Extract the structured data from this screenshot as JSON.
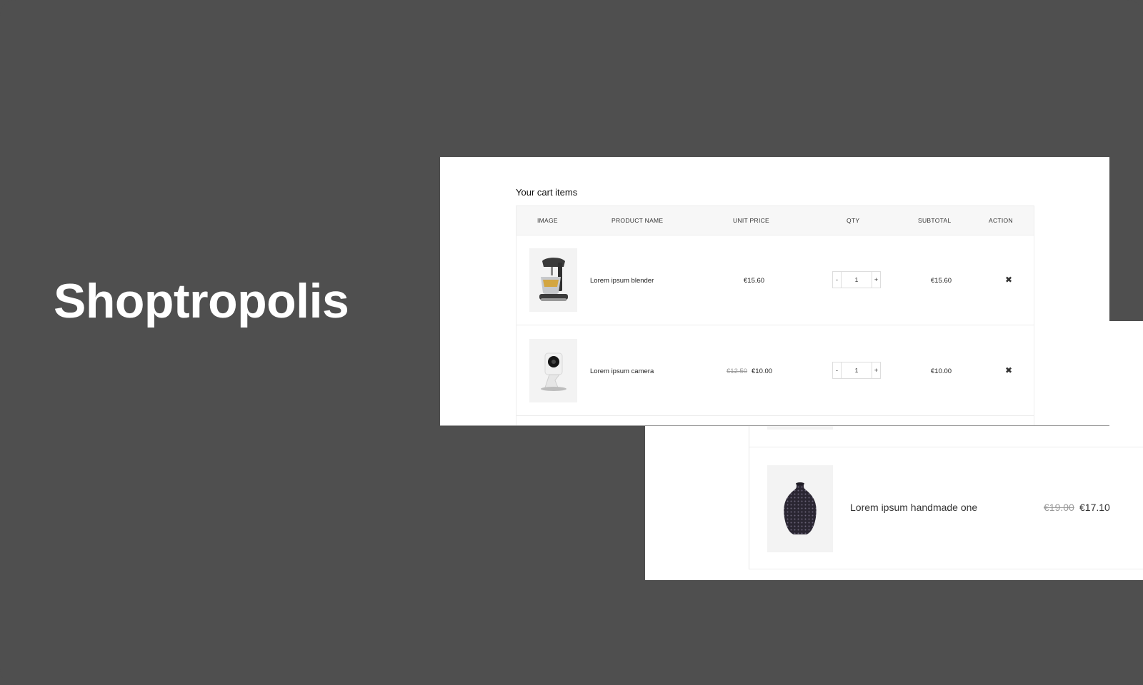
{
  "brand": {
    "name": "Shoptropolis"
  },
  "cart": {
    "title": "Your cart items",
    "columns": [
      "IMAGE",
      "PRODUCT NAME",
      "UNIT PRICE",
      "QTY",
      "SUBTOTAL",
      "ACTION"
    ],
    "rows": [
      {
        "image_icon": "mixer-image",
        "name": "Lorem ipsum blender",
        "old_price": "",
        "price": "€15.60",
        "qty": "1",
        "subtotal": "€15.60",
        "action_icon": "close-icon",
        "qty_minus": "-",
        "qty_plus": "+",
        "remove": "✖"
      },
      {
        "image_icon": "camera-image",
        "name": "Lorem ipsum camera",
        "old_price": "€12.50",
        "price": "€10.00",
        "qty": "1",
        "subtotal": "€10.00",
        "action_icon": "close-icon",
        "qty_minus": "-",
        "qty_plus": "+",
        "remove": "✖"
      }
    ]
  },
  "zoom": {
    "row": {
      "image_icon": "vase-image",
      "name": "Lorem ipsum handmade one",
      "old_price": "€19.00",
      "price": "€17.10"
    }
  }
}
